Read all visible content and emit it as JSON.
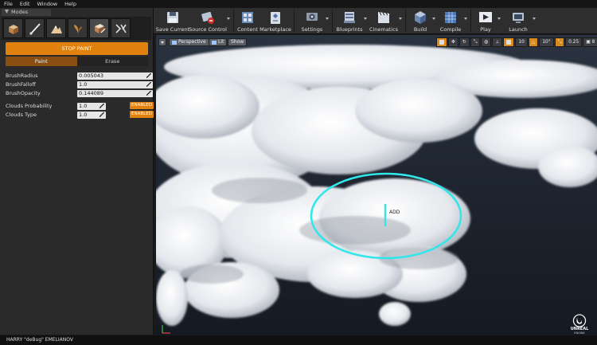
{
  "menu": [
    "File",
    "Edit",
    "Window",
    "Help"
  ],
  "modes": {
    "tab_label": "Modes",
    "icons": [
      "place-mode-icon",
      "paint-mode-icon",
      "landscape-mode-icon",
      "foliage-mode-icon",
      "mesh-paint-mode-icon",
      "geometry-mode-icon"
    ]
  },
  "panel": {
    "stop_paint": "STOP PAINT",
    "paint_tab": "Paint",
    "erase_tab": "Erase",
    "props": [
      {
        "label": "BrushRadius",
        "value": "0.005043"
      },
      {
        "label": "BrushFalloff",
        "value": "1.0"
      },
      {
        "label": "BrushOpacity",
        "value": "0.144089"
      }
    ],
    "clouds": [
      {
        "label": "Clouds Probability",
        "value": "1.0",
        "state": "ENABLED"
      },
      {
        "label": "Clouds Type",
        "value": "1.0",
        "state": "ENABLED"
      }
    ]
  },
  "toolbar": [
    {
      "label": "Save Current",
      "icon": "save-icon"
    },
    {
      "label": "Source Control",
      "icon": "source-control-icon"
    },
    {
      "label": "Content",
      "icon": "content-icon"
    },
    {
      "label": "Marketplace",
      "icon": "marketplace-icon"
    },
    {
      "label": "Settings",
      "icon": "settings-icon"
    },
    {
      "label": "Blueprints",
      "icon": "blueprints-icon"
    },
    {
      "label": "Cinematics",
      "icon": "cinematics-icon"
    },
    {
      "label": "Build",
      "icon": "build-icon"
    },
    {
      "label": "Compile",
      "icon": "compile-icon"
    },
    {
      "label": "Play",
      "icon": "play-icon"
    },
    {
      "label": "Launch",
      "icon": "launch-icon"
    }
  ],
  "viewport": {
    "perspective": "Perspective",
    "lit": "Lit",
    "show": "Show",
    "grid_value": "10",
    "angle_value": "10°",
    "scale_value": "0.25",
    "camera_speed": "8",
    "brush_label": "ADD"
  },
  "footer": {
    "author": "HARRY \"deBug\" EMELIANOV",
    "logo_line1": "UNREAL",
    "logo_line2": "ENGINE"
  },
  "colors": {
    "accent": "#e0820d",
    "brush_ring": "#33e6ea"
  }
}
